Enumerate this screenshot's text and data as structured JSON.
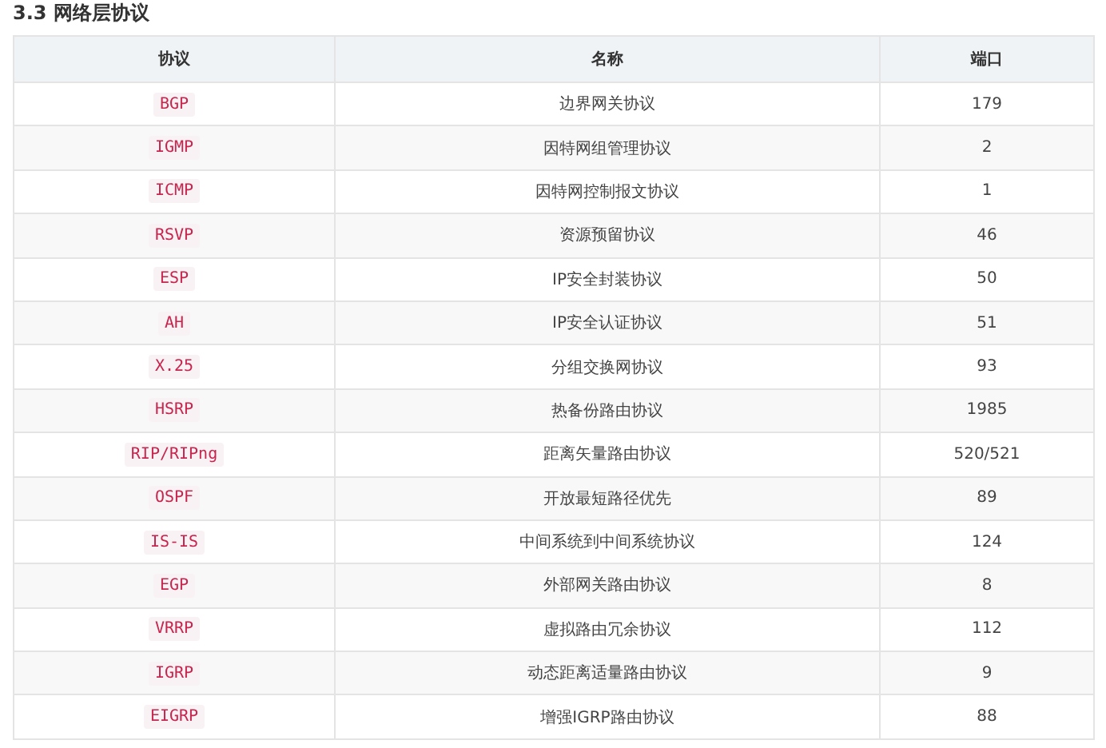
{
  "heading": "3.3 网络层协议",
  "table": {
    "columns": [
      "协议",
      "名称",
      "端口"
    ],
    "rows": [
      {
        "protocol": "BGP",
        "name": "边界网关协议",
        "port": "179"
      },
      {
        "protocol": "IGMP",
        "name": "因特网组管理协议",
        "port": "2"
      },
      {
        "protocol": "ICMP",
        "name": "因特网控制报文协议",
        "port": "1"
      },
      {
        "protocol": "RSVP",
        "name": "资源预留协议",
        "port": "46"
      },
      {
        "protocol": "ESP",
        "name": "IP安全封装协议",
        "port": "50"
      },
      {
        "protocol": "AH",
        "name": "IP安全认证协议",
        "port": "51"
      },
      {
        "protocol": "X.25",
        "name": "分组交换网协议",
        "port": "93"
      },
      {
        "protocol": "HSRP",
        "name": "热备份路由协议",
        "port": "1985"
      },
      {
        "protocol": "RIP/RIPng",
        "name": "距离矢量路由协议",
        "port": "520/521"
      },
      {
        "protocol": "OSPF",
        "name": "开放最短路径优先",
        "port": "89"
      },
      {
        "protocol": "IS-IS",
        "name": "中间系统到中间系统协议",
        "port": "124"
      },
      {
        "protocol": "EGP",
        "name": "外部网关路由协议",
        "port": "8"
      },
      {
        "protocol": "VRRP",
        "name": "虚拟路由冗余协议",
        "port": "112"
      },
      {
        "protocol": "IGRP",
        "name": "动态距离适量路由协议",
        "port": "9"
      },
      {
        "protocol": "EIGRP",
        "name": "增强IGRP路由协议",
        "port": "88"
      }
    ]
  }
}
